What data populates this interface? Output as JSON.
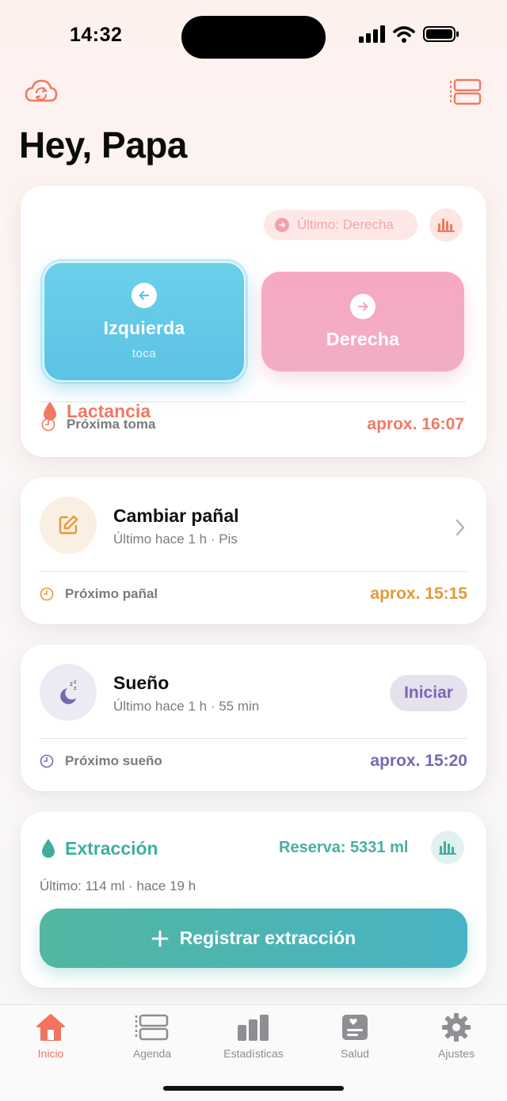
{
  "status_bar": {
    "time": "14:32"
  },
  "header": {
    "sync_icon": "cloud-sync-icon",
    "agenda_icon": "timeline-icon",
    "greeting": "Hey, Papa"
  },
  "lactancia": {
    "title": "Lactancia",
    "last_label": "Último: Derecha",
    "left_label": "Izquierda",
    "left_hint": "toca",
    "right_label": "Derecha",
    "next_label": "Próxima toma",
    "next_value": "aprox. 16:07",
    "accent": "#f07a63"
  },
  "panal": {
    "title": "Cambiar pañal",
    "subtitle": "Último hace 1 h · Pis",
    "next_label": "Próximo pañal",
    "next_value": "aprox. 15:15",
    "accent": "#e39a3d"
  },
  "sueno": {
    "title": "Sueño",
    "subtitle": "Último hace 1 h · 55 min",
    "start_label": "Iniciar",
    "next_label": "Próximo sueño",
    "next_value": "aprox. 15:20",
    "accent": "#7a67b4"
  },
  "extraccion": {
    "title": "Extracción",
    "reserve": "Reserva: 5331 ml",
    "last": "Último: 114 ml · hace 19 h",
    "button_label": "Registrar extracción",
    "accent": "#3fae9e"
  },
  "tabs": [
    {
      "label": "Inicio",
      "icon": "home-icon",
      "active": true
    },
    {
      "label": "Agenda",
      "icon": "agenda-icon",
      "active": false
    },
    {
      "label": "Estadísticas",
      "icon": "bar-chart-icon",
      "active": false
    },
    {
      "label": "Salud",
      "icon": "health-card-icon",
      "active": false
    },
    {
      "label": "Ajustes",
      "icon": "gear-icon",
      "active": false
    }
  ]
}
